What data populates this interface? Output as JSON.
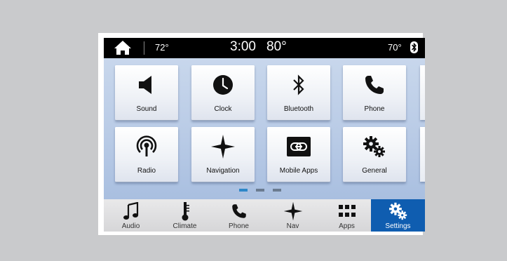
{
  "status_bar": {
    "outside_temp": "72°",
    "time": "3:00",
    "cabin_temp": "80°",
    "right_temp": "70°"
  },
  "tiles": [
    {
      "label": "Sound",
      "icon": "speaker-icon"
    },
    {
      "label": "Clock",
      "icon": "clock-icon"
    },
    {
      "label": "Bluetooth",
      "icon": "bluetooth-icon"
    },
    {
      "label": "Phone",
      "icon": "phone-icon"
    },
    {
      "label": "Radio",
      "icon": "radio-icon"
    },
    {
      "label": "Navigation",
      "icon": "navigation-icon"
    },
    {
      "label": "Mobile Apps",
      "icon": "link-icon"
    },
    {
      "label": "General",
      "icon": "gears-icon"
    }
  ],
  "pagination": {
    "pages": 3,
    "active": 1
  },
  "bottom_nav": [
    {
      "label": "Audio",
      "icon": "music-note-icon"
    },
    {
      "label": "Climate",
      "icon": "thermometer-icon"
    },
    {
      "label": "Phone",
      "icon": "phone-icon"
    },
    {
      "label": "Nav",
      "icon": "navigation-icon"
    },
    {
      "label": "Apps",
      "icon": "apps-grid-icon"
    },
    {
      "label": "Settings",
      "icon": "gears-icon",
      "active": true
    }
  ],
  "colors": {
    "active_tab": "#0f5db0",
    "active_dot": "#2d87c8"
  }
}
